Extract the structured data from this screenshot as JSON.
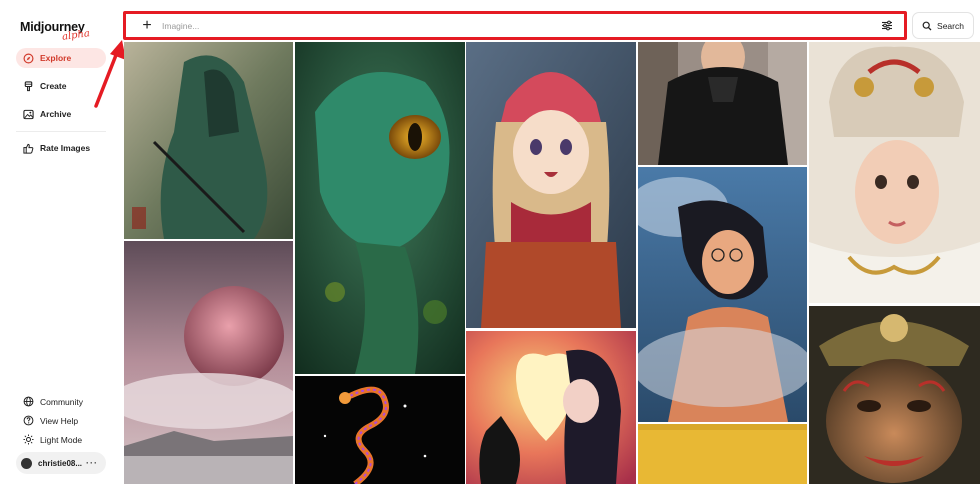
{
  "app": {
    "logo_text": "Midjourney",
    "logo_badge": "alpha"
  },
  "sidebar": {
    "items": [
      {
        "label": "Explore",
        "icon": "compass-icon",
        "active": true
      },
      {
        "label": "Create",
        "icon": "brush-icon",
        "active": false
      },
      {
        "label": "Archive",
        "icon": "image-icon",
        "active": false
      },
      {
        "label": "Rate Images",
        "icon": "thumbs-up-icon",
        "active": false
      }
    ],
    "bottom_items": [
      {
        "label": "Community",
        "icon": "globe-icon"
      },
      {
        "label": "View Help",
        "icon": "help-icon"
      },
      {
        "label": "Light Mode",
        "icon": "sun-icon"
      }
    ],
    "user": {
      "name": "christie08...",
      "more": "···"
    }
  },
  "topbar": {
    "imagine_placeholder": "Imagine...",
    "imagine_value": "",
    "search_label": "Search",
    "plus_icon": "plus-icon",
    "settings_icon": "sliders-icon",
    "search_icon": "search-icon"
  },
  "colors": {
    "accent": "#d13a2b",
    "active_bg": "#fde6e4",
    "annotation": "#e51b23"
  },
  "gallery": {
    "images": [
      "green-armored-warrior",
      "pink-planet-sky",
      "jade-dragon-closeup",
      "neon-dragon-on-black",
      "anime-girl-in-snow",
      "girl-with-cat-and-heart",
      "woman-in-black-puffer-coat",
      "woman-with-glasses-in-smoke",
      "yellow-abstract",
      "child-in-dragon-headdress",
      "ornate-golden-mask"
    ]
  }
}
